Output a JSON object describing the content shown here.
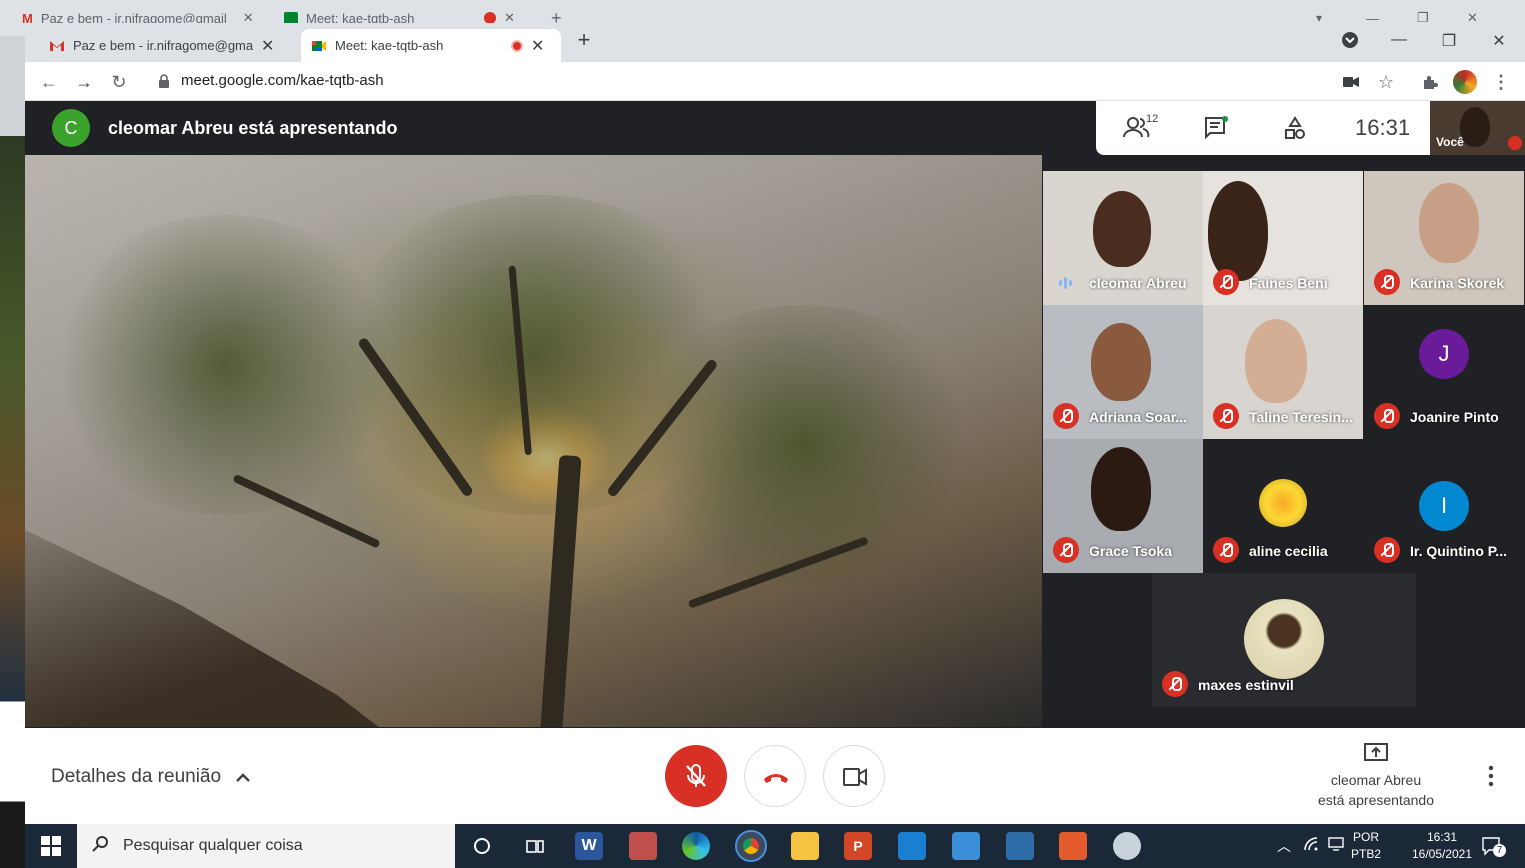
{
  "background_window": {
    "tabs": [
      {
        "title": "Paz e bem - ir.nifragome@gmail",
        "close": "✕"
      },
      {
        "title": "Meet: kae-tqtb-ash",
        "close": "✕"
      }
    ],
    "new_tab": "+"
  },
  "browser": {
    "tabs": [
      {
        "title": "Paz e bem - ir.nifragome@gmail.",
        "close": "✕"
      },
      {
        "title": "Meet: kae-tqtb-ash",
        "close": "✕"
      }
    ],
    "new_tab": "+",
    "url": "meet.google.com/kae-tqtb-ash"
  },
  "meet": {
    "presenter_initial": "C",
    "presenter_text": "cleomar Abreu está apresentando",
    "participant_count": "12",
    "clock": "16:31",
    "self_label": "Você",
    "participants": [
      {
        "name": "cleomar Abreu",
        "muted": false
      },
      {
        "name": "Faines Beni",
        "muted": true
      },
      {
        "name": "Karina Skorek",
        "muted": true
      },
      {
        "name": "Adriana Soar...",
        "muted": true
      },
      {
        "name": "Taline Teresin...",
        "muted": true
      },
      {
        "name": "Joanire Pinto",
        "muted": true,
        "initial": "J"
      },
      {
        "name": "Grace Tsoka",
        "muted": true
      },
      {
        "name": "aline cecilia",
        "muted": true
      },
      {
        "name": "Ir. Quintino P...",
        "muted": true,
        "initial": "I"
      },
      {
        "name": "maxes estinvil",
        "muted": true
      }
    ],
    "details_label": "Detalhes da reunião",
    "presenting_label_line1": "cleomar Abreu",
    "presenting_label_line2": "está apresentando"
  },
  "taskbar": {
    "search_placeholder": "Pesquisar qualquer coisa",
    "lang_line1": "POR",
    "lang_line2": "PTB2",
    "time": "16:31",
    "date": "16/05/2021",
    "notification_count": "7"
  },
  "colors": {
    "meet_bg": "#202124",
    "mute_red": "#d93025",
    "presenter_green": "#3ba22c",
    "avatar_purple": "#6a1b9a",
    "avatar_blue": "#0288d1"
  }
}
